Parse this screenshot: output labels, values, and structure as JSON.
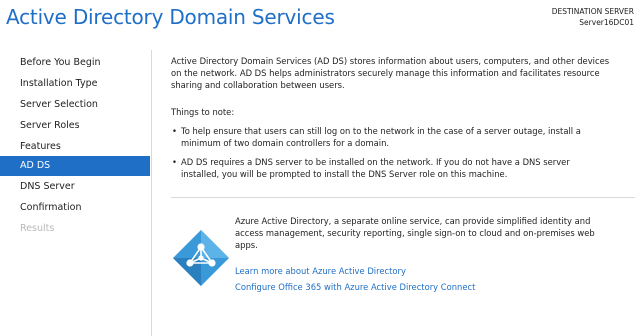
{
  "header": {
    "title": "Active Directory Domain Services",
    "destination_label": "DESTINATION SERVER",
    "server_name": "Server16DC01"
  },
  "sidebar": {
    "items": [
      {
        "label": "Before You Begin",
        "state": "normal"
      },
      {
        "label": "Installation Type",
        "state": "normal"
      },
      {
        "label": "Server Selection",
        "state": "normal"
      },
      {
        "label": "Server Roles",
        "state": "normal"
      },
      {
        "label": "Features",
        "state": "normal"
      },
      {
        "label": "AD DS",
        "state": "active"
      },
      {
        "label": "DNS Server",
        "state": "normal"
      },
      {
        "label": "Confirmation",
        "state": "normal"
      },
      {
        "label": "Results",
        "state": "disabled"
      }
    ]
  },
  "main": {
    "intro_lines": [
      "Active Directory Domain Services (AD DS) stores information about users, computers, and other devices",
      "on the network.  AD DS helps administrators securely manage this information and facilitates resource",
      "sharing and collaboration between users."
    ],
    "things_to_note": "Things to note:",
    "bullets": [
      {
        "lines": [
          "To help ensure that users can still log on to the network in the case of a server outage, install a",
          "minimum of two domain controllers for a domain."
        ]
      },
      {
        "lines": [
          "AD DS requires a DNS server to be installed on the network.  If you do not have a DNS server",
          "installed, you will be prompted to install the DNS Server role on this machine."
        ]
      }
    ],
    "bullet_char": "•"
  },
  "azure": {
    "icon": "azure-active-directory-icon",
    "description_lines": [
      "Azure Active Directory, a separate online service, can provide simplified identity and",
      "access management, security reporting, single sign-on to cloud and on-premises web",
      "apps."
    ],
    "link_learn_more": "Learn more about Azure Active Directory",
    "link_configure": "Configure Office 365 with Azure Active Directory Connect"
  },
  "colors": {
    "accent": "#1f6fc7",
    "azure_icon": "#3a9ad9"
  }
}
